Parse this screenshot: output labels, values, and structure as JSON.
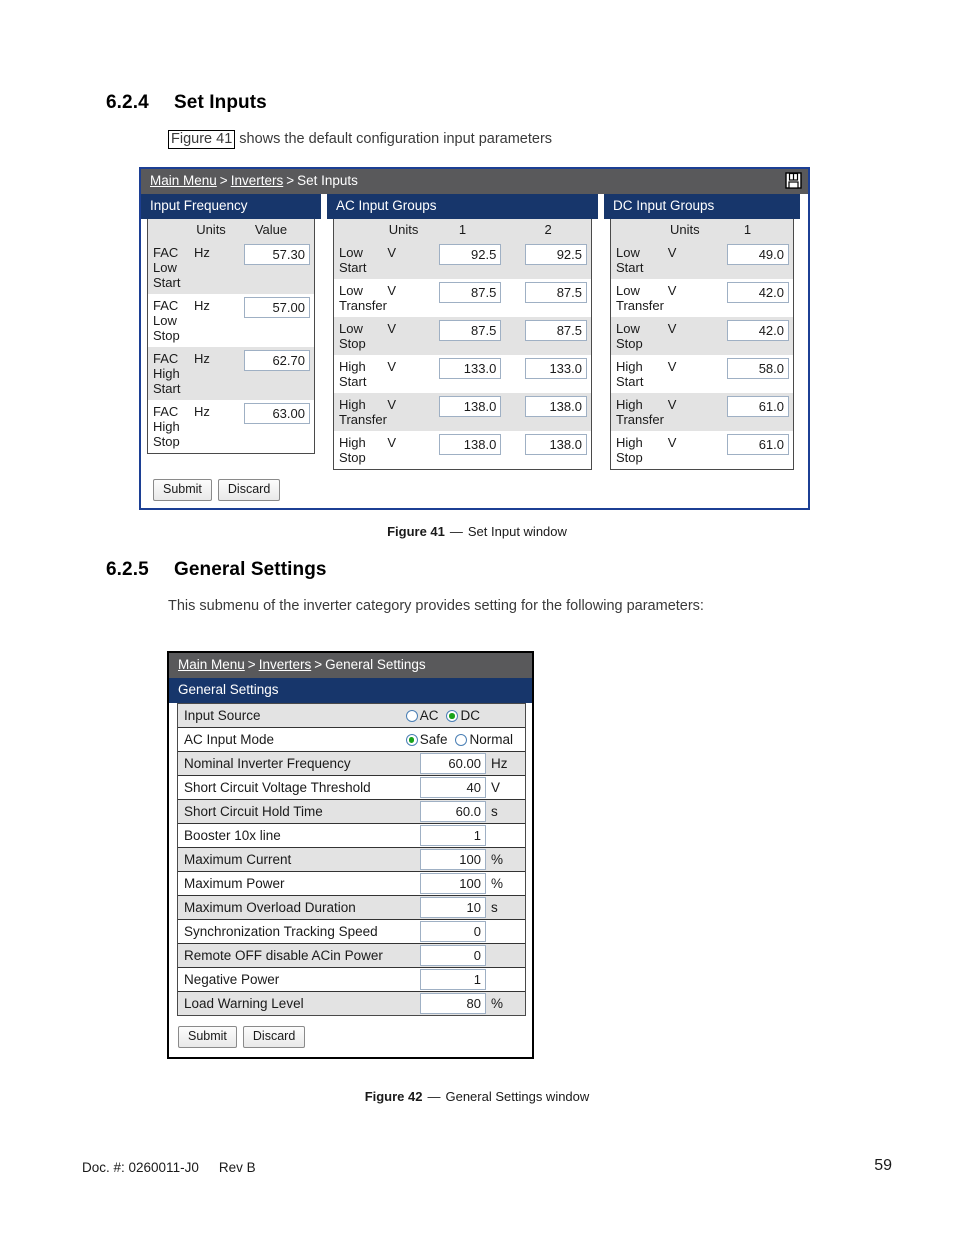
{
  "document": {
    "footer_doc": "Doc. #: 0260011-J0",
    "footer_rev": "Rev B",
    "page_number": "59"
  },
  "section_624": {
    "number": "6.2.4",
    "title": "Set Inputs",
    "intro_ref": "Figure 41",
    "intro_rest": " shows the default configuration input parameters",
    "caption_label": "Figure 41",
    "caption_dash": "—",
    "caption_text": "Set Input window"
  },
  "section_625": {
    "number": "6.2.5",
    "title": "General Settings",
    "intro": "This submenu of the inverter category provides setting for the following parameters:",
    "caption_label": "Figure 42",
    "caption_dash": "—",
    "caption_text": "General Settings window"
  },
  "figure41": {
    "breadcrumb": {
      "main_menu": "Main Menu",
      "sep1": ">",
      "inverters": "Inverters",
      "sep2": ">",
      "current": "Set Inputs"
    },
    "save_icon": "save-floppy-icon",
    "input_frequency": {
      "title": "Input Frequency",
      "headers": [
        "",
        "Units",
        "Value"
      ],
      "rows": [
        {
          "label": "FAC Low Start",
          "units": "Hz",
          "value": "57.30"
        },
        {
          "label": "FAC Low Stop",
          "units": "Hz",
          "value": "57.00"
        },
        {
          "label": "FAC High Start",
          "units": "Hz",
          "value": "62.70"
        },
        {
          "label": "FAC High Stop",
          "units": "Hz",
          "value": "63.00"
        }
      ]
    },
    "ac_input_groups": {
      "title": "AC Input Groups",
      "headers": [
        "",
        "Units",
        "1",
        "2"
      ],
      "rows": [
        {
          "label": "Low Start",
          "units": "V",
          "v1": "92.5",
          "v2": "92.5"
        },
        {
          "label": "Low Transfer",
          "units": "V",
          "v1": "87.5",
          "v2": "87.5"
        },
        {
          "label": "Low Stop",
          "units": "V",
          "v1": "87.5",
          "v2": "87.5"
        },
        {
          "label": "High Start",
          "units": "V",
          "v1": "133.0",
          "v2": "133.0"
        },
        {
          "label": "High Transfer",
          "units": "V",
          "v1": "138.0",
          "v2": "138.0"
        },
        {
          "label": "High Stop",
          "units": "V",
          "v1": "138.0",
          "v2": "138.0"
        }
      ]
    },
    "dc_input_groups": {
      "title": "DC Input Groups",
      "headers": [
        "",
        "Units",
        "1"
      ],
      "rows": [
        {
          "label": "Low Start",
          "units": "V",
          "v1": "49.0"
        },
        {
          "label": "Low Transfer",
          "units": "V",
          "v1": "42.0"
        },
        {
          "label": "Low Stop",
          "units": "V",
          "v1": "42.0"
        },
        {
          "label": "High Start",
          "units": "V",
          "v1": "58.0"
        },
        {
          "label": "High Transfer",
          "units": "V",
          "v1": "61.0"
        },
        {
          "label": "High Stop",
          "units": "V",
          "v1": "61.0"
        }
      ]
    },
    "submit_label": "Submit",
    "discard_label": "Discard"
  },
  "figure42": {
    "breadcrumb": {
      "main_menu": "Main Menu",
      "sep1": ">",
      "inverters": "Inverters",
      "sep2": ">",
      "current": "General Settings"
    },
    "panel_title": "General Settings",
    "rows": [
      {
        "label": "Input Source",
        "type": "radio",
        "options": [
          {
            "label": "AC",
            "selected": false
          },
          {
            "label": "DC",
            "selected": true
          }
        ]
      },
      {
        "label": "AC Input Mode",
        "type": "radio",
        "options": [
          {
            "label": "Safe",
            "selected": true
          },
          {
            "label": "Normal",
            "selected": false
          }
        ]
      },
      {
        "label": "Nominal Inverter Frequency",
        "type": "value",
        "value": "60.00",
        "unit": "Hz"
      },
      {
        "label": "Short Circuit Voltage Threshold",
        "type": "value",
        "value": "40",
        "unit": "V"
      },
      {
        "label": "Short Circuit Hold Time",
        "type": "value",
        "value": "60.0",
        "unit": "s"
      },
      {
        "label": "Booster 10x line",
        "type": "value",
        "value": "1",
        "unit": ""
      },
      {
        "label": "Maximum Current",
        "type": "value",
        "value": "100",
        "unit": "%"
      },
      {
        "label": "Maximum Power",
        "type": "value",
        "value": "100",
        "unit": "%"
      },
      {
        "label": "Maximum Overload Duration",
        "type": "value",
        "value": "10",
        "unit": "s"
      },
      {
        "label": "Synchronization Tracking Speed",
        "type": "value",
        "value": "0",
        "unit": ""
      },
      {
        "label": "Remote OFF disable ACin Power",
        "type": "value",
        "value": "0",
        "unit": ""
      },
      {
        "label": "Negative Power",
        "type": "value",
        "value": "1",
        "unit": ""
      },
      {
        "label": "Load Warning Level",
        "type": "value",
        "value": "80",
        "unit": "%"
      }
    ],
    "submit_label": "Submit",
    "discard_label": "Discard"
  },
  "colors": {
    "panel_header": "#17366b",
    "breadcrumb": "#59595b",
    "figure41_border": "#1c3f94",
    "figure42_border": "#000000",
    "row_shade": "#e3e3e3",
    "radio_selected": "#19a31b"
  }
}
